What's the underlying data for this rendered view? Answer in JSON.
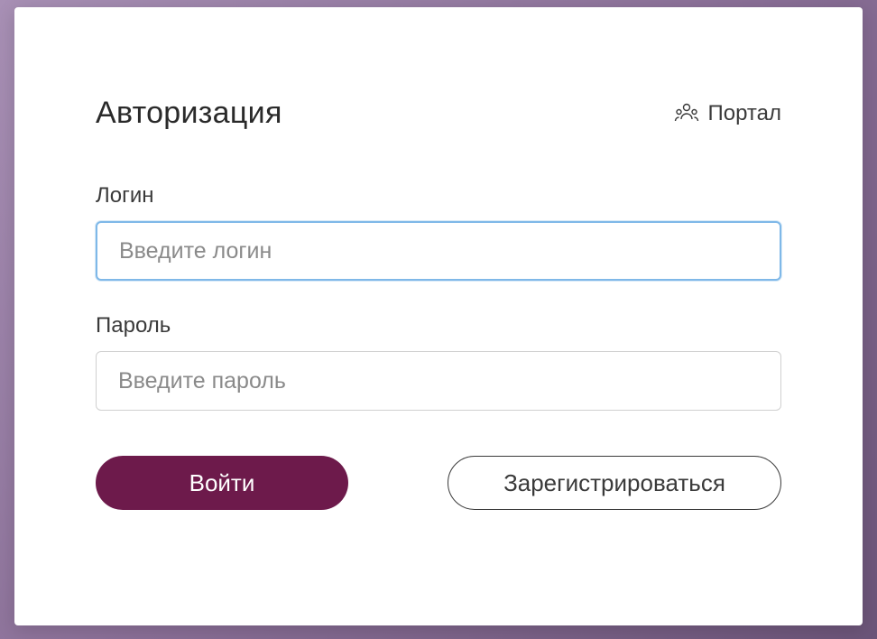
{
  "dialog": {
    "title": "Авторизация",
    "portal": {
      "label": "Портал"
    },
    "login": {
      "label": "Логин",
      "placeholder": "Введите логин",
      "value": ""
    },
    "password": {
      "label": "Пароль",
      "placeholder": "Введите пароль",
      "value": ""
    },
    "buttons": {
      "login_label": "Войти",
      "register_label": "Зарегистрироваться"
    }
  },
  "colors": {
    "primary": "#6d1a4b",
    "focus": "#7fb8e8"
  }
}
